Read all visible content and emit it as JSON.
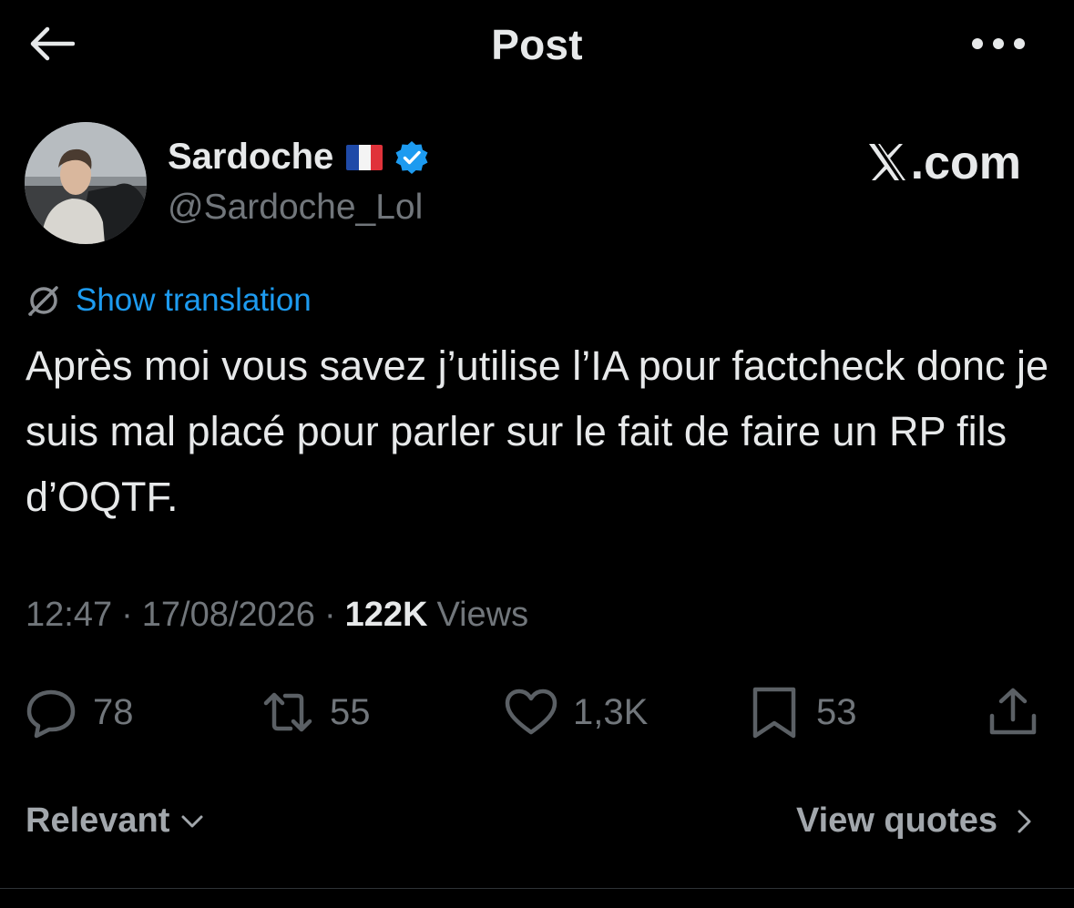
{
  "header": {
    "title": "Post",
    "back_icon": "arrow-left-icon",
    "more_icon": "more-horizontal-icon"
  },
  "author": {
    "name": "Sardoche",
    "flag_icon": "france-flag-icon",
    "verified_icon": "verified-badge-icon",
    "handle": "@Sardoche_Lol",
    "avatar_icon": "user-avatar"
  },
  "brand": {
    "logo_icon": "x-logo-icon",
    "text": ".com"
  },
  "translation": {
    "icon": "translate-icon",
    "label": "Show translation"
  },
  "post": {
    "text": "Après moi vous savez j’utilise l’IA pour factcheck donc je suis mal placé pour parler sur le fait de faire un RP fils d’OQTF."
  },
  "meta": {
    "time": "12:47",
    "separator": "·",
    "date": "17/08/2026",
    "views_count": "122K",
    "views_label": "Views"
  },
  "actions": {
    "reply": {
      "icon": "reply-icon",
      "count": "78"
    },
    "retweet": {
      "icon": "retweet-icon",
      "count": "55"
    },
    "like": {
      "icon": "heart-icon",
      "count": "1,3K"
    },
    "bookmark": {
      "icon": "bookmark-icon",
      "count": "53"
    },
    "share": {
      "icon": "share-icon"
    }
  },
  "footer": {
    "sort_label": "Relevant",
    "sort_icon": "chevron-down-icon",
    "quotes_label": "View quotes",
    "quotes_icon": "chevron-right-icon"
  },
  "colors": {
    "background": "#000000",
    "text": "#e7e9ea",
    "muted": "#71767b",
    "link": "#1d9bf0",
    "verified": "#1d9bf0"
  }
}
